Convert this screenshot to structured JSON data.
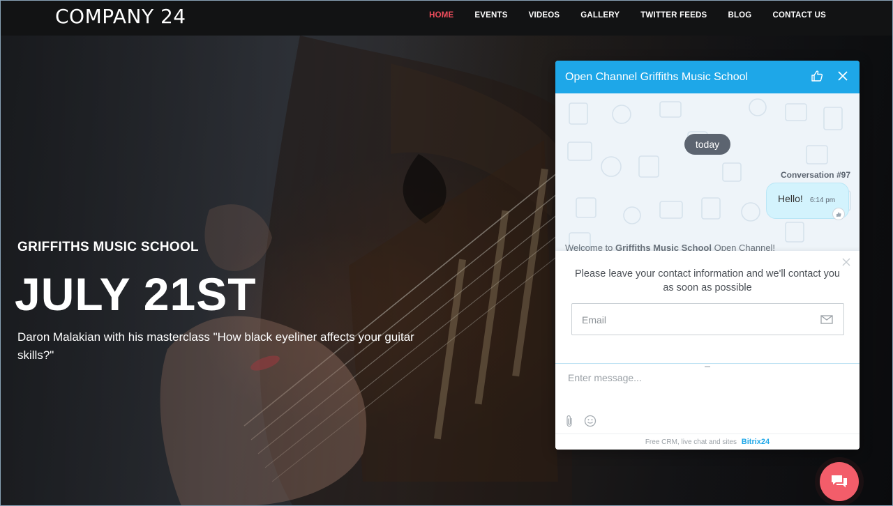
{
  "site": {
    "logo": "COMPANY 24",
    "nav": [
      {
        "label": "HOME",
        "active": true
      },
      {
        "label": "EVENTS"
      },
      {
        "label": "VIDEOS"
      },
      {
        "label": "GALLERY"
      },
      {
        "label": "TWITTER FEEDS"
      },
      {
        "label": "BLOG"
      },
      {
        "label": "CONTACT US"
      }
    ],
    "active_color": "#ef4d5c"
  },
  "hero": {
    "subtitle": "GRIFFITHS MUSIC SCHOOL",
    "title": "JULY 21ST",
    "description": "Daron Malakian with his masterclass \"How black eyeliner affects your guitar skills?\""
  },
  "chat": {
    "header_title": "Open Channel Griffiths Music School",
    "header_color": "#1ea7e8",
    "date_pill": "today",
    "conversation_label": "Conversation #97",
    "message": {
      "text": "Hello!",
      "time": "6:14 pm"
    },
    "welcome_prefix": "Welcome to ",
    "welcome_bold": "Griffiths Music School",
    "welcome_suffix": " Open Channel!",
    "contact_prompt": "Please leave your contact information and we'll contact you as soon as possible",
    "email_placeholder": "Email",
    "message_placeholder": "Enter message...",
    "footer_text": "Free CRM, live chat and sites",
    "footer_brand": "Bitrix",
    "footer_brand_num": "24"
  },
  "icons": {
    "like": "thumbs-up-icon",
    "close": "close-icon",
    "mail": "envelope-icon",
    "attach": "paperclip-icon",
    "emoji": "smile-icon",
    "fab": "chat-bubbles-icon"
  }
}
